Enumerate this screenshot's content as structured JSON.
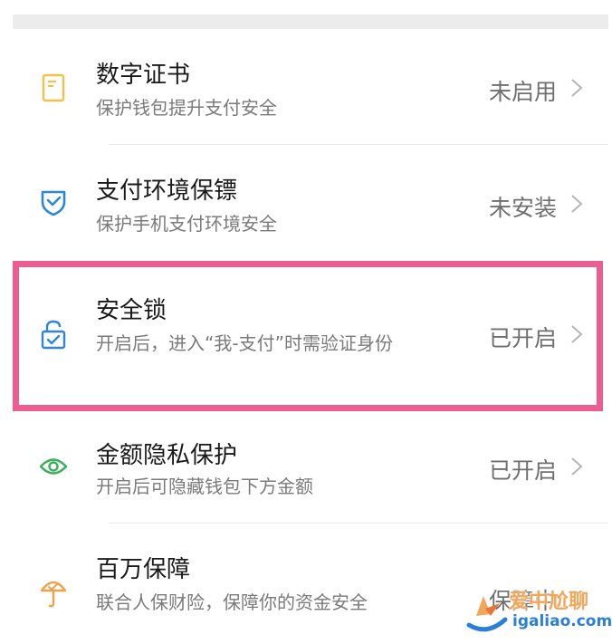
{
  "items": [
    {
      "title": "数字证书",
      "subtitle": "保护钱包提升支付安全",
      "status": "未启用",
      "icon": "certificate-icon",
      "icon_color": "#f1c24b"
    },
    {
      "title": "支付环境保镖",
      "subtitle": "保护手机支付环境安全",
      "status": "未安装",
      "icon": "shield-check-icon",
      "icon_color": "#2f86d8"
    },
    {
      "title": "安全锁",
      "subtitle": "开启后，进入“我-支付”时需验证身份",
      "status": "已开启",
      "icon": "lock-check-icon",
      "icon_color": "#2f86d8"
    },
    {
      "title": "金额隐私保护",
      "subtitle": "开启后可隐藏钱包下方金额",
      "status": "已开启",
      "icon": "eye-icon",
      "icon_color": "#3dae5c"
    },
    {
      "title": "百万保障",
      "subtitle": "联合人保财险，保障你的资金安全",
      "status": "保障中",
      "icon": "umbrella-icon",
      "icon_color": "#f0a24a"
    }
  ],
  "highlight_color": "#ec5d91",
  "watermark": {
    "text": "爱中尬聊",
    "url": "igaliao.com"
  }
}
